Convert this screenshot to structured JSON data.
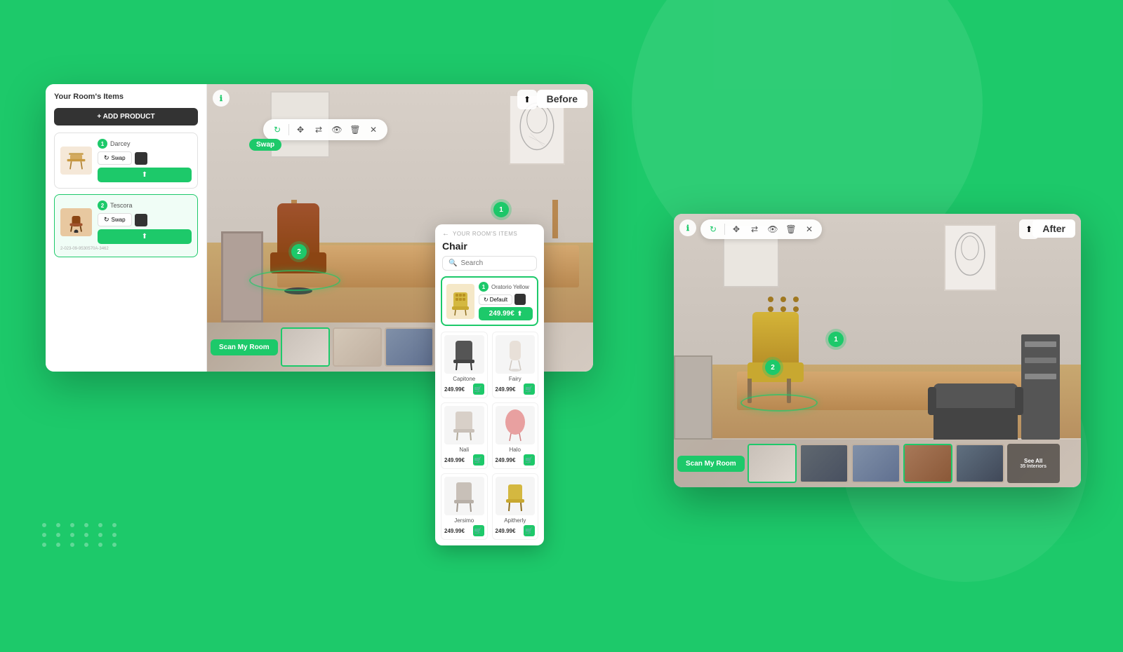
{
  "background_color": "#1dc96a",
  "before_panel": {
    "label": "Before",
    "sidebar_title": "Your Room's Items",
    "add_product_label": "+ ADD PRODUCT",
    "products": [
      {
        "id": 1,
        "name": "Darcey",
        "num": "1",
        "swap_label": "Swap",
        "action_icon": "share",
        "product_id": "2-023-09-9530570A-3462"
      },
      {
        "id": 2,
        "name": "Tescora",
        "num": "2",
        "swap_label": "Swap",
        "action_icon": "share",
        "selected": true
      }
    ],
    "info_icon": "ℹ",
    "share_icon": "⬆",
    "scan_room_label": "Scan My Room",
    "toolbar_icons": [
      "↻",
      "✥",
      "⬡",
      "👁",
      "🗑",
      "✕"
    ],
    "swap_bubble": "Swap",
    "item_markers": [
      {
        "num": "1",
        "hint": "desk marker"
      },
      {
        "num": "2",
        "hint": "chair marker"
      }
    ]
  },
  "after_panel": {
    "label": "After",
    "info_icon": "ℹ",
    "share_icon": "⬆",
    "scan_room_label": "Scan My Room",
    "see_all_label": "See All",
    "see_all_count": "35 Interiors",
    "item_markers": [
      {
        "num": "1",
        "hint": "desk marker"
      },
      {
        "num": "2",
        "hint": "chair marker"
      }
    ]
  },
  "product_panel": {
    "back_label": "YOUR ROOM'S ITEMS",
    "title": "Chair",
    "search_placeholder": "Search",
    "selected_product": {
      "name": "Oratorio Yellow",
      "num": "1",
      "default_label": "Default",
      "price": "249.99€",
      "action_icon": "share"
    },
    "products": [
      {
        "name": "Capitone",
        "price": "249.99€",
        "color": "#555"
      },
      {
        "name": "Fairy",
        "price": "249.99€",
        "color": "#e8e0d8"
      },
      {
        "name": "Nali",
        "price": "249.99€",
        "color": "#d8d0c8"
      },
      {
        "name": "Halo",
        "price": "249.99€",
        "color": "#e8a0a0"
      },
      {
        "name": "Jersimo",
        "price": "249.99€",
        "color": "#c8c0b8"
      },
      {
        "name": "Apitherly",
        "price": "249.99€",
        "color": "#d4b840"
      }
    ]
  }
}
